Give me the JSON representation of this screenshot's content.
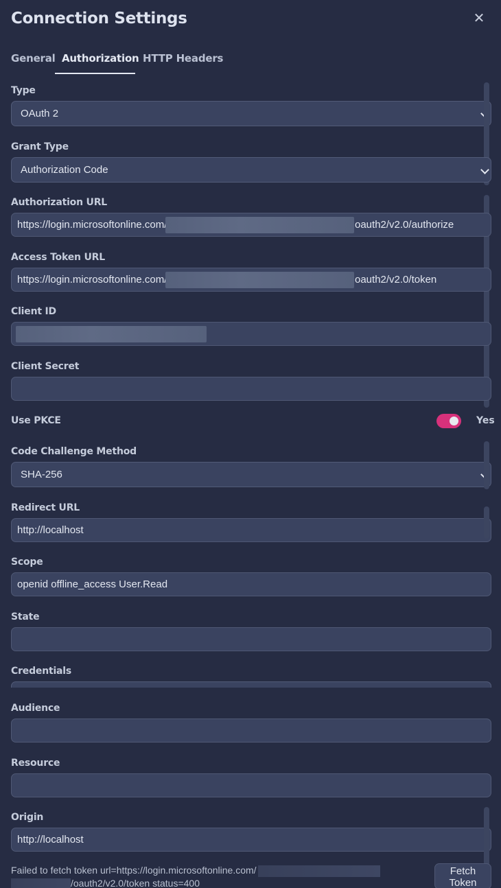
{
  "title": "Connection Settings",
  "tabs": [
    "General",
    "Authorization",
    "HTTP Headers"
  ],
  "active_tab": "Authorization",
  "form": {
    "type": {
      "label": "Type",
      "value": "OAuth 2"
    },
    "grant_type": {
      "label": "Grant Type",
      "value": "Authorization Code"
    },
    "authorization_url": {
      "label": "Authorization URL",
      "prefix": "https://login.microsoftonline.com/",
      "suffix": "oauth2/v2.0/authorize"
    },
    "access_token_url": {
      "label": "Access Token URL",
      "prefix": "https://login.microsoftonline.com/",
      "suffix": "oauth2/v2.0/token"
    },
    "client_id": {
      "label": "Client ID",
      "value": ""
    },
    "client_secret": {
      "label": "Client Secret",
      "value": ""
    },
    "use_pkce": {
      "label": "Use PKCE",
      "enabled": true,
      "state_text": "Yes"
    },
    "code_challenge_method": {
      "label": "Code Challenge Method",
      "value": "SHA-256"
    },
    "redirect_url": {
      "label": "Redirect URL",
      "value": "http://localhost"
    },
    "scope": {
      "label": "Scope",
      "value": "openid offline_access User.Read"
    },
    "state": {
      "label": "State",
      "value": ""
    },
    "credentials": {
      "label": "Credentials"
    },
    "audience": {
      "label": "Audience",
      "value": ""
    },
    "resource": {
      "label": "Resource",
      "value": ""
    },
    "origin": {
      "label": "Origin",
      "value": "http://localhost"
    }
  },
  "error": {
    "line1": "Failed to fetch token url=https://login.microsoftonline.com/",
    "line2": "/oauth2/v2.0/token status=400"
  },
  "fetch_button": {
    "line1": "Fetch",
    "line2": "Token"
  },
  "colors": {
    "accent_toggle": "#d7317b",
    "background": "#262c43",
    "field": "#3a4360"
  }
}
